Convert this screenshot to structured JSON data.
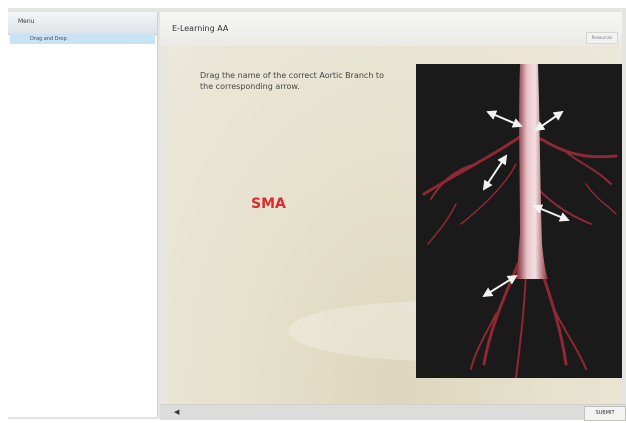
{
  "sidebar": {
    "title": "Menu",
    "items": [
      {
        "label": "Drag and Drop",
        "selected": true
      }
    ]
  },
  "header": {
    "title": "E-Learning AA",
    "corner_button": "Resources"
  },
  "question": {
    "instructions": "Drag the name of the correct Aortic Branch to the corresponding arrow.",
    "drag_item": "SMA"
  },
  "footer": {
    "sound_icon": "◀",
    "submit_label": "SUBMIT"
  },
  "colors": {
    "drag_item": "#e0282e",
    "menu_selected": "#c7e3f4",
    "image_background": "#1a1a1a"
  },
  "icons": {
    "sound": "speaker-icon"
  }
}
